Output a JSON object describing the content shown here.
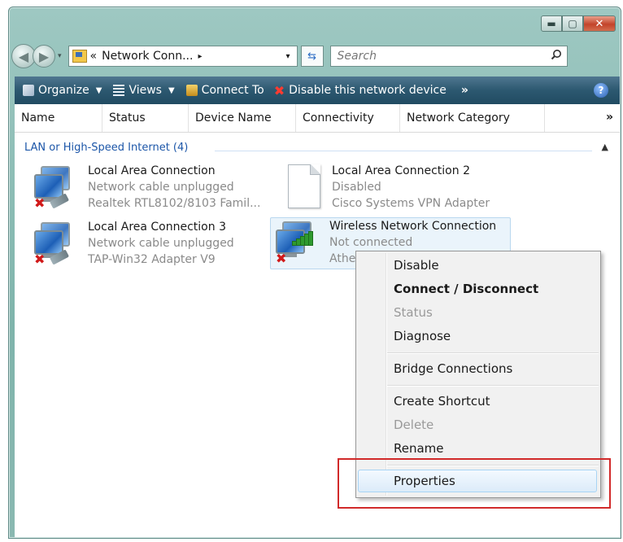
{
  "window": {
    "buttons": {
      "minimize": "▬",
      "maximize": "▢",
      "close": "✕"
    }
  },
  "address_bar": {
    "prefix": "«",
    "location": "Network Conn...",
    "crumb_arrow": "▸",
    "dropdown_glyph": "▾",
    "refresh_glyph": "⇆",
    "search_placeholder": "Search",
    "search_glyph": "⌕"
  },
  "toolbar": {
    "organize": "Organize",
    "views": "Views",
    "connect_to": "Connect To",
    "disable_device": "Disable this network device",
    "overflow": "»",
    "help": "?"
  },
  "columns": {
    "headers": [
      "Name",
      "Status",
      "Device Name",
      "Connectivity",
      "Network Category"
    ],
    "more": "»"
  },
  "group": {
    "label": "LAN or High-Speed Internet (4)"
  },
  "connections": [
    {
      "name": "Local Area Connection",
      "status": "Network cable unplugged",
      "device": "Realtek RTL8102/8103 Famil...",
      "icon": "wired-network-disconnected"
    },
    {
      "name": "Local Area Connection 2",
      "status": "Disabled",
      "device": "Cisco Systems VPN Adapter",
      "icon": "disabled-adapter-document"
    },
    {
      "name": "Local Area Connection 3",
      "status": "Network cable unplugged",
      "device": "TAP-Win32 Adapter V9",
      "icon": "wired-network-disconnected"
    },
    {
      "name": "Wireless Network Connection",
      "status": "Not connected",
      "device": "Athe",
      "icon": "wireless-network-disconnected"
    }
  ],
  "context_menu": {
    "items": [
      {
        "label": "Disable",
        "state": "normal"
      },
      {
        "label": "Connect / Disconnect",
        "state": "bold"
      },
      {
        "label": "Status",
        "state": "disabled"
      },
      {
        "label": "Diagnose",
        "state": "normal"
      },
      {
        "label": "Bridge Connections",
        "state": "normal"
      },
      {
        "label": "Create Shortcut",
        "state": "normal"
      },
      {
        "label": "Delete",
        "state": "disabled"
      },
      {
        "label": "Rename",
        "state": "normal"
      },
      {
        "label": "Properties",
        "state": "highlighted"
      }
    ]
  },
  "colors": {
    "toolbar": "#2c5870",
    "group_label": "#1c56a8",
    "annotation_box": "#d12a2a",
    "menu_highlight": "#dcebf9"
  }
}
